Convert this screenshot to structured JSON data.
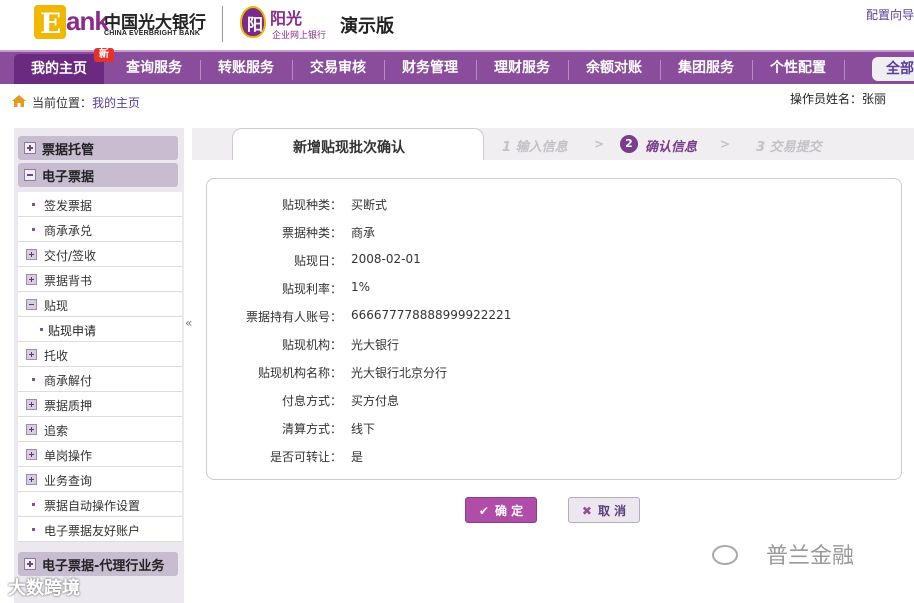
{
  "header": {
    "logo_letter": "E",
    "logo_text": "ank",
    "bank_name_cn": "中国光大银行",
    "bank_name_en": "CHINA EVERBRIGHT BANK",
    "product_name": "阳光",
    "product_sub": "企业网上银行",
    "product_badge": "阳",
    "demo_label": "演示版",
    "config_link": "配置向导"
  },
  "nav": {
    "new_badge": "新",
    "items": [
      {
        "label": "我的主页"
      },
      {
        "label": "查询服务"
      },
      {
        "label": "转账服务"
      },
      {
        "label": "交易审核"
      },
      {
        "label": "财务管理"
      },
      {
        "label": "理财服务"
      },
      {
        "label": "余额对账"
      },
      {
        "label": "集团服务"
      },
      {
        "label": "个性配置"
      }
    ],
    "all_label": "全部"
  },
  "breadcrumb": {
    "label": "当前位置：",
    "current": "我的主页"
  },
  "operator": "操作员姓名：张丽",
  "sidebar": {
    "groups": [
      {
        "label": "票据托管",
        "collapsed": true
      },
      {
        "label": "电子票据",
        "collapsed": false
      },
      {
        "label": "电子票据-代理行业务",
        "collapsed": true
      }
    ],
    "items": [
      {
        "label": "签发票据",
        "type": "leaf"
      },
      {
        "label": "商承承兑",
        "type": "leaf"
      },
      {
        "label": "交付/签收",
        "type": "collapsed"
      },
      {
        "label": "票据背书",
        "type": "collapsed"
      },
      {
        "label": "贴现",
        "type": "expanded"
      },
      {
        "label": "贴现申请",
        "type": "leaf",
        "selected": true
      },
      {
        "label": "托收",
        "type": "collapsed"
      },
      {
        "label": "商承解付",
        "type": "leaf"
      },
      {
        "label": "票据质押",
        "type": "collapsed"
      },
      {
        "label": "追索",
        "type": "collapsed"
      },
      {
        "label": "单岗操作",
        "type": "collapsed"
      },
      {
        "label": "业务查询",
        "type": "collapsed"
      },
      {
        "label": "票据自动操作设置",
        "type": "leaf"
      },
      {
        "label": "电子票据友好账户",
        "type": "leaf"
      }
    ],
    "collapse_glyph": "«"
  },
  "steps": {
    "active_tab": "新增贴现批次确认",
    "items": [
      {
        "label": "1  输入信息"
      },
      {
        "num": "2",
        "label": "确认信息",
        "current": true
      },
      {
        "label": "3  交易提交"
      }
    ],
    "arrow": ">"
  },
  "form": {
    "rows": [
      {
        "label": "贴现种类：",
        "value": "买断式"
      },
      {
        "label": "票据种类：",
        "value": "商承"
      },
      {
        "label": "贴现日：",
        "value": "2008-02-01"
      },
      {
        "label": "贴现利率：",
        "value": "1%"
      },
      {
        "label": "票据持有人账号：",
        "value": "666677778888999922221"
      },
      {
        "label": "贴现机构：",
        "value": "光大银行"
      },
      {
        "label": "贴现机构名称：",
        "value": "光大银行北京分行"
      },
      {
        "label": "付息方式：",
        "value": "买方付息"
      },
      {
        "label": "清算方式：",
        "value": "线下"
      },
      {
        "label": "是否可转让：",
        "value": "是"
      }
    ]
  },
  "buttons": {
    "ok": "确 定",
    "cancel": "取 消"
  },
  "watermarks": {
    "bottom_right": "普兰金融",
    "bottom_left": "大数跨境"
  },
  "colors": {
    "brand_purple": "#8a4d9c",
    "accent_purple": "#7a3d8e",
    "logo_gold": "#f0b800"
  }
}
